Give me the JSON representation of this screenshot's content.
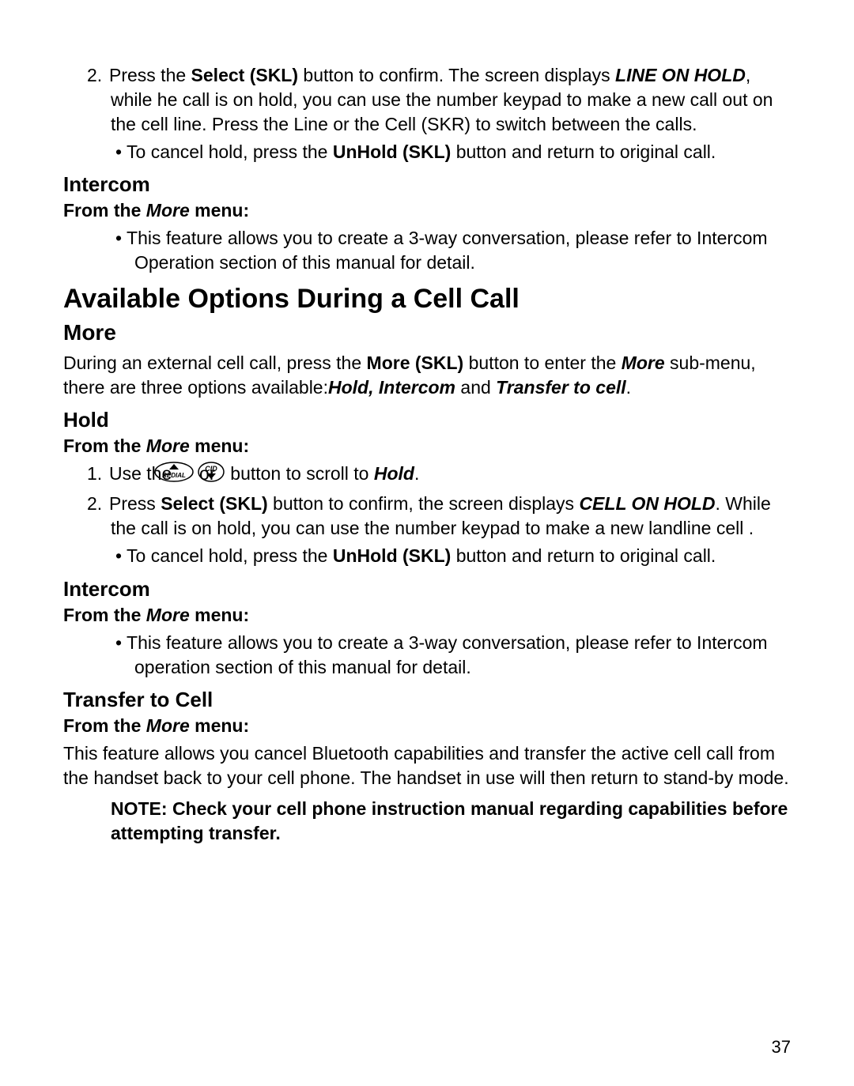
{
  "step2": {
    "num": "2.",
    "t1": "Press the ",
    "b1": "Select (SKL)",
    "t2": " button to confirm. The screen displays ",
    "bi1": "LINE ON HOLD",
    "t3": ", while he call is on hold, you can use the number keypad to make a new call out on the cell line. Press the Line or the Cell (SKR) to switch between the calls."
  },
  "cancel1": {
    "t1": "To cancel hold, press the ",
    "b1": "UnHold (SKL)",
    "t2": " button and return to original call."
  },
  "intercom1": {
    "title": "Intercom",
    "from_t1": "From the ",
    "from_bi": "More",
    "from_t2": " menu:",
    "bullet": "This feature allows you to create a 3-way conversation, please refer to Intercom Operation section of this manual for detail."
  },
  "main_title": "Available Options During a Cell Call",
  "more_title": "More",
  "more_para": {
    "t1": "During an external cell call, press the ",
    "b1": "More (SKL)",
    "t2": " button to enter the ",
    "bi1": "More",
    "t3": " sub-menu, there are three options available:",
    "bi2": "Hold, Intercom",
    "t4": " and ",
    "bi3": "Transfer to cell",
    "t5": "."
  },
  "hold": {
    "title": "Hold",
    "from_t1": "From the ",
    "from_bi": "More",
    "from_t2": " menu:",
    "step1_num": "1.",
    "step1_t1": "Use the ",
    "step1_t2": " or ",
    "step1_t3": " button to scroll to ",
    "step1_bi": "Hold",
    "step1_t4": ".",
    "step2_num": "2.",
    "step2_t1": "Press ",
    "step2_b1": "Select (SKL)",
    "step2_t2": " button to confirm, the screen displays ",
    "step2_bi1": "CELL ON HOLD",
    "step2_t3": ". While the call is on hold, you can use the number keypad to make a new landline cell .",
    "cancel_t1": "To cancel hold, press the ",
    "cancel_b1": "UnHold (SKL)",
    "cancel_t2": " button and return to original call."
  },
  "intercom2": {
    "title": "Intercom",
    "from_t1": "From the ",
    "from_bi": "More",
    "from_t2": " menu:",
    "bullet": "This feature allows you to create a 3-way conversation, please refer to Intercom operation section of this manual for detail."
  },
  "transfer": {
    "title": "Transfer to Cell",
    "from_t1": "From the ",
    "from_bi": "More",
    "from_t2": " menu:",
    "para": "This feature allows you cancel Bluetooth capabilities and transfer the active cell call from the handset back to your cell phone. The handset in use will then return to stand-by mode."
  },
  "note": "NOTE: Check your cell phone instruction manual regarding capabilities before attempting transfer.",
  "page_number": "37"
}
